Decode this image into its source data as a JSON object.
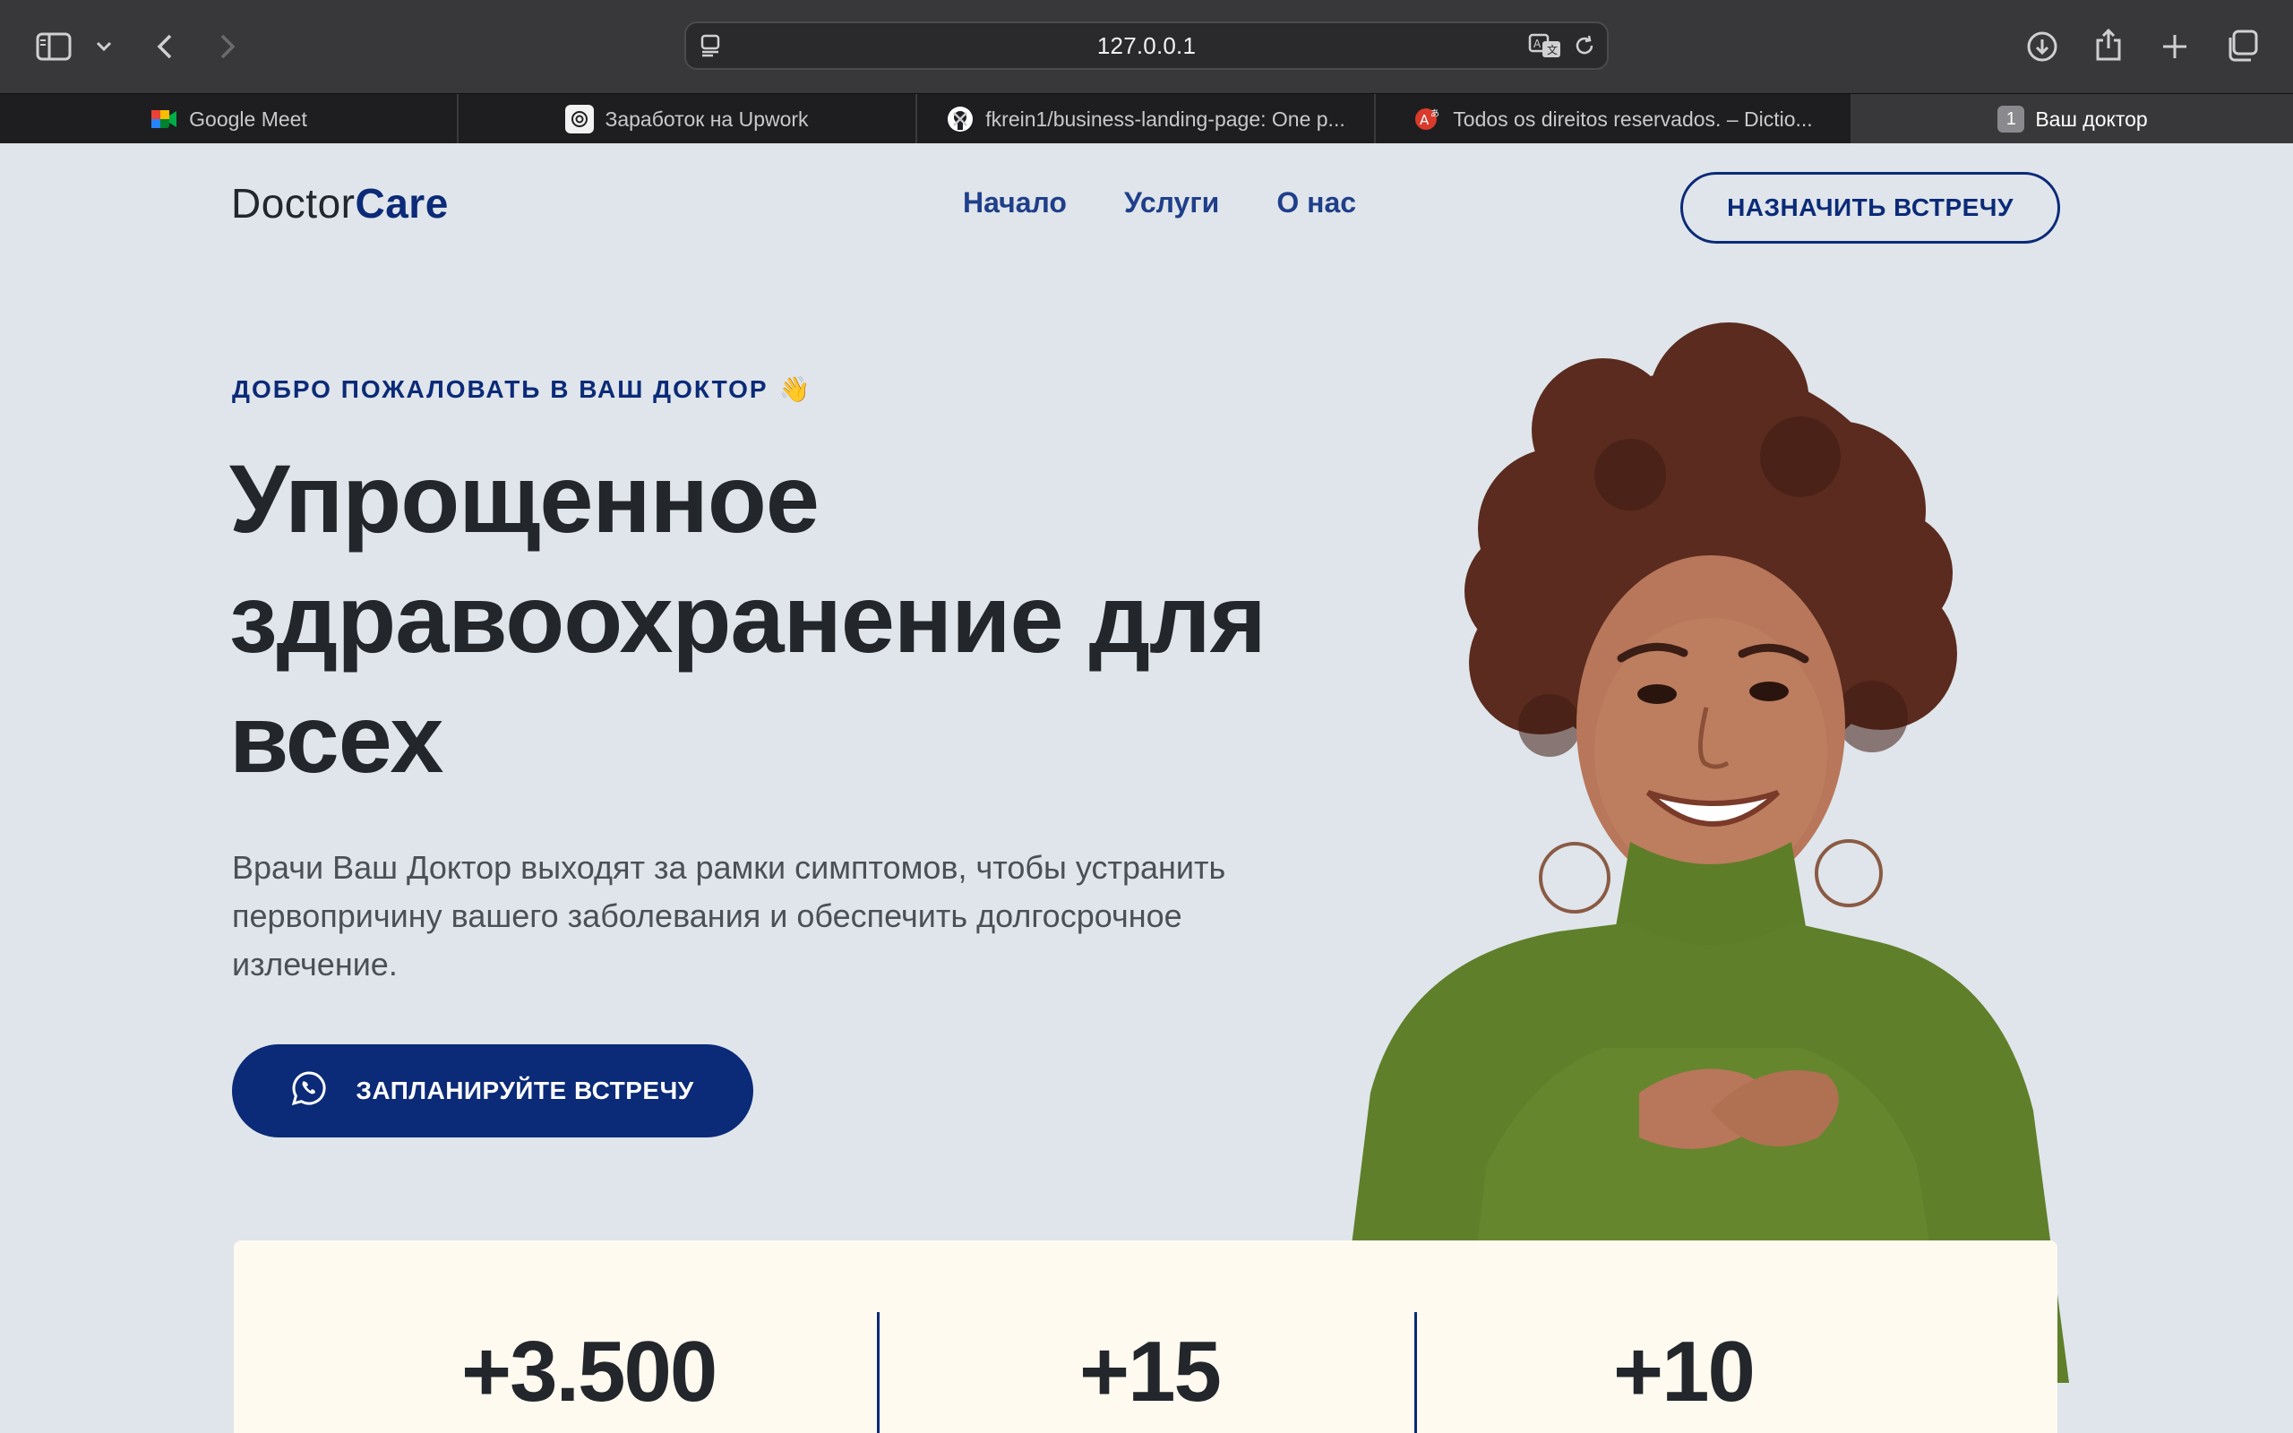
{
  "browser": {
    "url": "127.0.0.1",
    "tabs": [
      {
        "title": "Google Meet",
        "icon": "google-meet-icon"
      },
      {
        "title": "Заработок на Upwork",
        "icon": "chatgpt-icon"
      },
      {
        "title": "fkrein1/business-landing-page: One p...",
        "icon": "github-icon"
      },
      {
        "title": "Todos os direitos reservados. – Dictio...",
        "icon": "dictionary-icon"
      },
      {
        "title": "Ваш доктор",
        "count": "1",
        "active": true
      }
    ]
  },
  "header": {
    "logo_part1": "Doctor",
    "logo_part2": "Care",
    "nav": [
      "Начало",
      "Услуги",
      "О нас"
    ],
    "cta": "НАЗНАЧИТЬ ВСТРЕЧУ"
  },
  "hero": {
    "eyebrow": "ДОБРО ПОЖАЛОВАТЬ В ВАШ ДОКТОР",
    "eyebrow_emoji": "👋",
    "title": "Упрощенное здравоохранение для всех",
    "lead": "Врачи Ваш Доктор выходят за рамки симптомов, чтобы устранить первопричину вашего заболевания и обеспечить долгосрочное излечение.",
    "button": "ЗАПЛАНИРУЙТЕ ВСТРЕЧУ",
    "button_icon": "whatsapp-icon"
  },
  "stats": [
    "+3.500",
    "+15",
    "+10"
  ],
  "colors": {
    "brand": "#0b2a78",
    "page_bg": "#dfe5ea",
    "card_bg": "#fffaf0",
    "text_dark": "#23262b"
  }
}
